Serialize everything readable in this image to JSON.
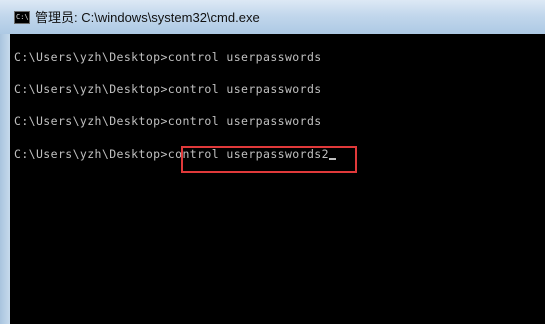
{
  "window": {
    "title": "管理员: C:\\windows\\system32\\cmd.exe",
    "icon": "cmd-icon",
    "icon_text": "C:\\"
  },
  "console": {
    "lines": [
      "C:\\Users\\yzh\\Desktop>control userpasswords",
      "C:\\Users\\yzh\\Desktop>control userpasswords",
      "C:\\Users\\yzh\\Desktop>control userpasswords",
      "C:\\Users\\yzh\\Desktop>control userpasswords2"
    ],
    "foreground_color": "#c0c0c0",
    "background_color": "#000000"
  },
  "annotation": {
    "highlight_color": "#e0393a"
  }
}
